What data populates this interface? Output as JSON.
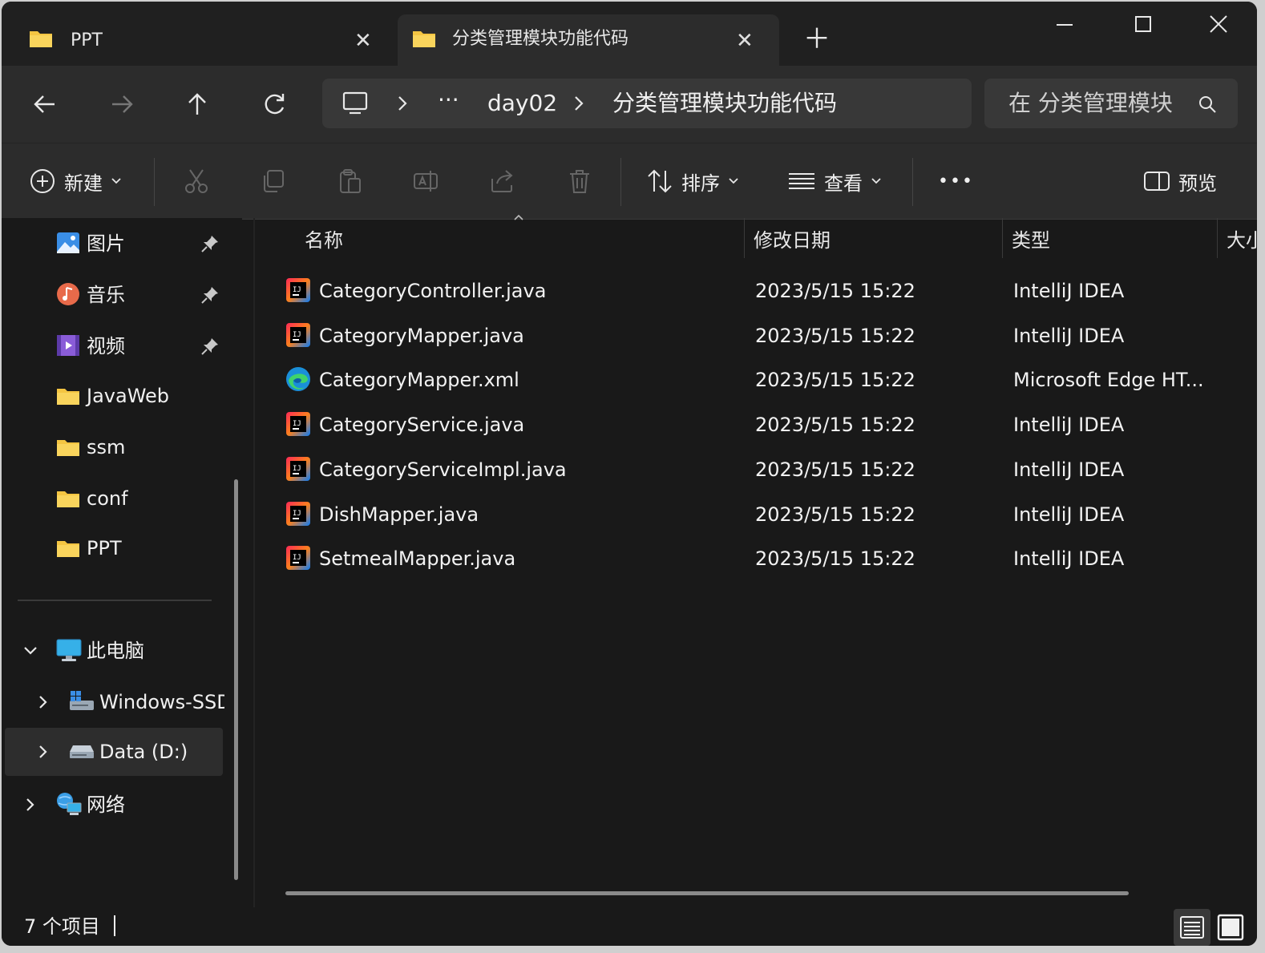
{
  "tabs": [
    {
      "label": "PPT",
      "icon": "folder-icon"
    },
    {
      "label": "分类管理模块功能代码",
      "icon": "folder-icon",
      "active": true
    }
  ],
  "address": {
    "ellipsis": "···",
    "crumbs": [
      "day02",
      "分类管理模块功能代码"
    ]
  },
  "search": {
    "placeholder": "在 分类管理模块"
  },
  "toolbar": {
    "new_label": "新建",
    "sort_label": "排序",
    "view_label": "查看",
    "more_label": "•••",
    "preview_label": "预览"
  },
  "sidebar": {
    "quick": [
      {
        "label": "图片",
        "icon": "pictures-icon",
        "pinned": true
      },
      {
        "label": "音乐",
        "icon": "music-icon",
        "pinned": true
      },
      {
        "label": "视频",
        "icon": "videos-icon",
        "pinned": true
      },
      {
        "label": "JavaWeb",
        "icon": "folder-icon"
      },
      {
        "label": "ssm",
        "icon": "folder-icon"
      },
      {
        "label": "conf",
        "icon": "folder-icon"
      },
      {
        "label": "PPT",
        "icon": "folder-icon"
      }
    ],
    "this_pc": "此电脑",
    "drives": [
      {
        "label": "Windows-SSD",
        "icon": "windows-drive-icon"
      },
      {
        "label": "Data (D:)",
        "icon": "drive-icon",
        "selected": true
      }
    ],
    "network": "网络"
  },
  "columns": {
    "name": "名称",
    "date": "修改日期",
    "type": "类型",
    "size": "大小"
  },
  "files": [
    {
      "name": "CategoryController.java",
      "date": "2023/5/15 15:22",
      "type": "IntelliJ IDEA",
      "icon": "intellij-icon"
    },
    {
      "name": "CategoryMapper.java",
      "date": "2023/5/15 15:22",
      "type": "IntelliJ IDEA",
      "icon": "intellij-icon"
    },
    {
      "name": "CategoryMapper.xml",
      "date": "2023/5/15 15:22",
      "type": "Microsoft Edge HT...",
      "icon": "edge-icon"
    },
    {
      "name": "CategoryService.java",
      "date": "2023/5/15 15:22",
      "type": "IntelliJ IDEA",
      "icon": "intellij-icon"
    },
    {
      "name": "CategoryServiceImpl.java",
      "date": "2023/5/15 15:22",
      "type": "IntelliJ IDEA",
      "icon": "intellij-icon"
    },
    {
      "name": "DishMapper.java",
      "date": "2023/5/15 15:22",
      "type": "IntelliJ IDEA",
      "icon": "intellij-icon"
    },
    {
      "name": "SetmealMapper.java",
      "date": "2023/5/15 15:22",
      "type": "IntelliJ IDEA",
      "icon": "intellij-icon"
    }
  ],
  "status": {
    "count": "7 个项目"
  },
  "colors": {
    "folder": "#f4c542",
    "accent": "#4cc2ff",
    "background": "#191919",
    "chrome": "#2c2c2c"
  }
}
